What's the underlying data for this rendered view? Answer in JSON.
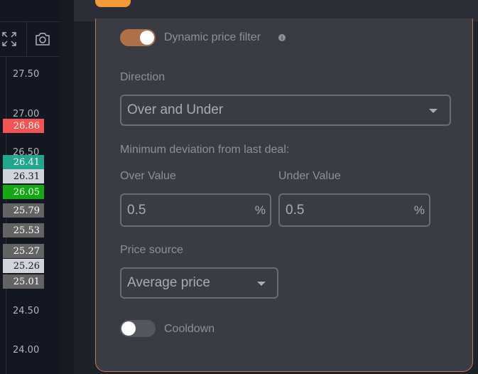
{
  "price_axis": {
    "ticks": [
      "27.50",
      "27.00",
      "26.50",
      "24.50",
      "24.00"
    ],
    "tags": [
      {
        "label": "26.86",
        "bg": "#f25454",
        "fg": "#ffffff"
      },
      {
        "label": "26.41",
        "bg": "#22a68e",
        "fg": "#ffffff"
      },
      {
        "label": "26.31",
        "bg": "#d1d4dc",
        "fg": "#131722"
      },
      {
        "label": "26.05",
        "bg": "#14a814",
        "fg": "#ffffff"
      },
      {
        "label": "25.79",
        "bg": "#636363",
        "fg": "#ffffff"
      },
      {
        "label": "25.53",
        "bg": "#636363",
        "fg": "#ffffff"
      },
      {
        "label": "25.27",
        "bg": "#636363",
        "fg": "#ffffff"
      },
      {
        "label": "25.26",
        "bg": "#d1d4dc",
        "fg": "#131722"
      },
      {
        "label": "25.01",
        "bg": "#636363",
        "fg": "#ffffff"
      }
    ],
    "tools": [
      "fullscreen-icon",
      "camera-icon"
    ]
  },
  "panel": {
    "dynamic_filter": {
      "label": "Dynamic price filter",
      "enabled": true,
      "accent": "#b07049"
    },
    "direction": {
      "label": "Direction",
      "value": "Over and Under"
    },
    "min_deviation": {
      "label": "Minimum deviation from last deal:",
      "over": {
        "label": "Over Value",
        "value": "0.5",
        "unit": "%"
      },
      "under": {
        "label": "Under Value",
        "value": "0.5",
        "unit": "%"
      }
    },
    "price_source": {
      "label": "Price source",
      "value": "Average price"
    },
    "cooldown": {
      "label": "Cooldown",
      "enabled": false
    }
  }
}
